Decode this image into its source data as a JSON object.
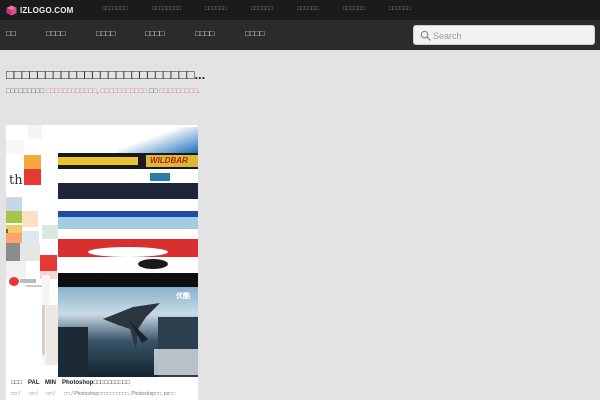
{
  "app": {
    "logo_text": "IZLOGO.COM",
    "accent_color": "#e06aa2"
  },
  "topbar": {
    "links": [
      "□□□□□□□",
      "□□□□□□□□",
      "□□□□□□",
      "□□□□□□",
      "□□□□□□",
      "□□□□□□",
      "□□□□□□"
    ]
  },
  "nav": {
    "items": [
      "□□",
      "□□□□",
      "□□□□",
      "□□□□",
      "□□□□",
      "□□□□"
    ]
  },
  "search": {
    "placeholder": "Search",
    "value": ""
  },
  "page": {
    "title": "□□□□□□□□□□□□□□□□□□□□□□□□...",
    "subline_prefix": "□□□□□□□□□ ",
    "subline_link1": "□□□□□□□□□□□□",
    "subline_sep1": ", ",
    "subline_link2": "□□□□□□□□□□□",
    "subline_and": " □□ ",
    "subline_link3": "□□□□□□□□□",
    "subline_end": "."
  },
  "cards": {
    "label_1": "□□□",
    "label_2": "PAL",
    "label_3": "MIN",
    "label_4": "Photoshop□□□□□□□□□□",
    "meta_1": "□□ /",
    "meta_2": "□□ /",
    "meta_3": "□□ /",
    "meta_4": "□□ / Photoshop□□□□□□□□□□, Photoshop□□, ps□□",
    "banner_text": "WILDBAR",
    "overlay_text": "优酷",
    "word_fragment": "th"
  }
}
